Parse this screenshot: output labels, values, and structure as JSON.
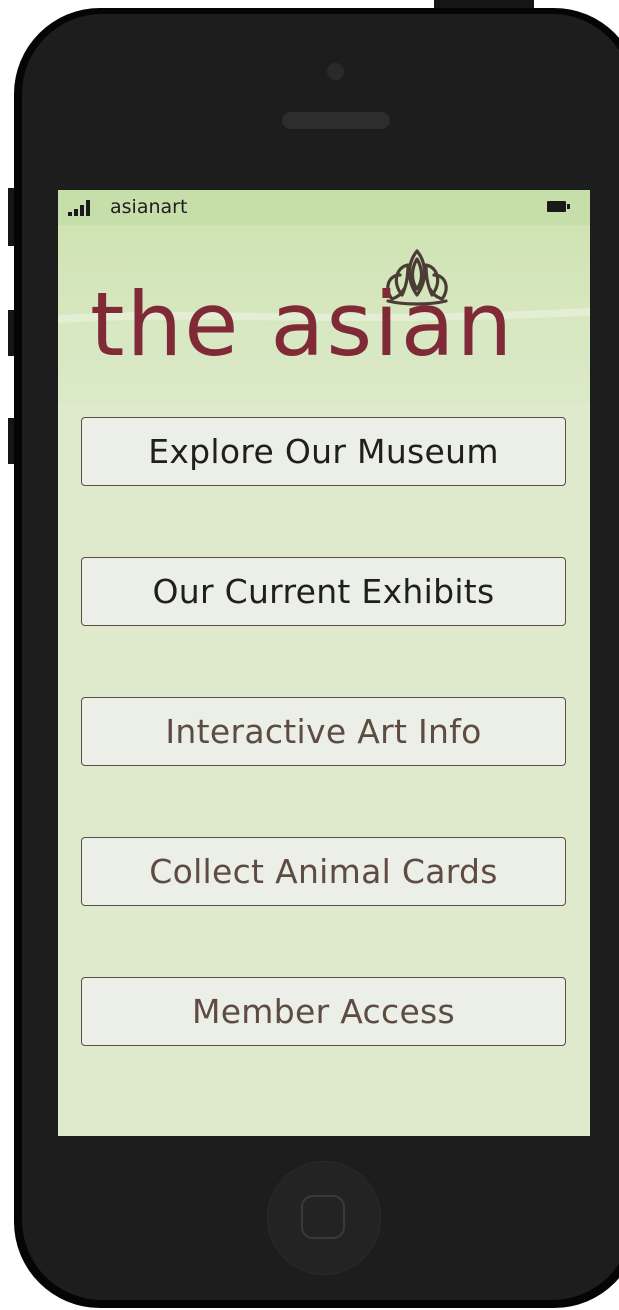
{
  "status_bar": {
    "carrier": "asianart",
    "signal_icon": "signal-bars-icon",
    "battery_icon": "battery-icon"
  },
  "header": {
    "logo_text": "the asian",
    "logo_icon": "lotus-icon"
  },
  "menu": {
    "items": [
      {
        "label": "Explore Our Museum",
        "color": "#1f1f1f"
      },
      {
        "label": "Our Current Exhibits",
        "color": "#1f1f1f"
      },
      {
        "label": "Interactive Art Info",
        "color": "#5e4c43"
      },
      {
        "label": "Collect Animal Cards",
        "color": "#5e4c43"
      },
      {
        "label": "Member Access",
        "color": "#5e4c43"
      }
    ]
  },
  "colors": {
    "brand": "#7f2a36",
    "screen_bg": "#dfeacd",
    "status_bar_bg": "#c6dfaa",
    "button_bg": "#ecefe7",
    "button_border": "#5d4d44"
  }
}
